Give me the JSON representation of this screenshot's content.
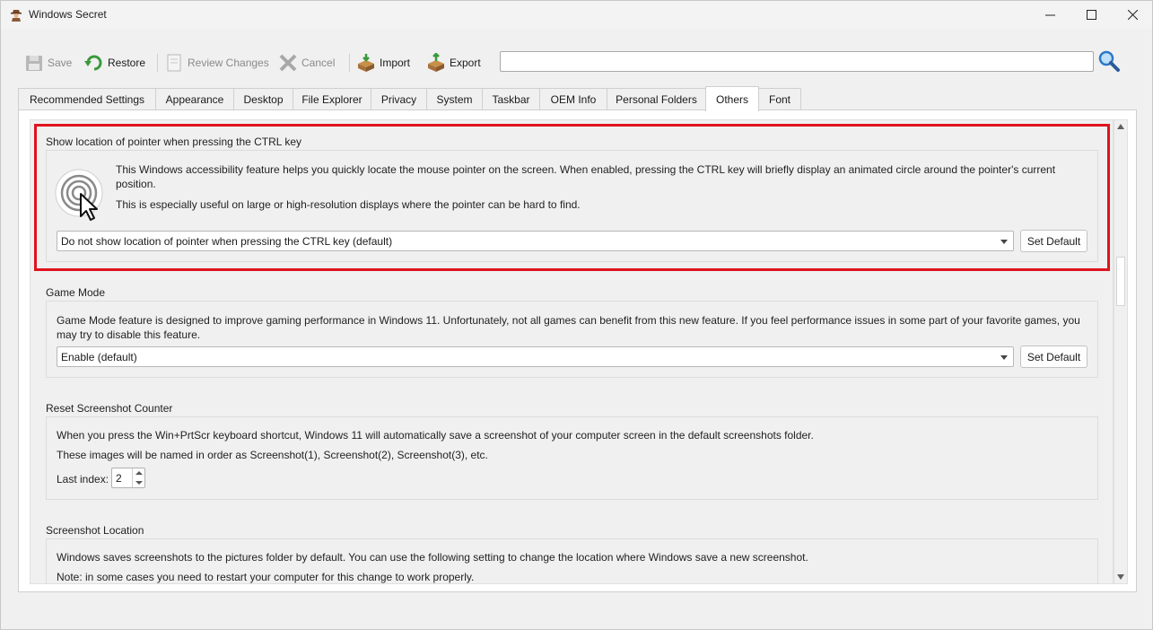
{
  "window": {
    "title": "Windows Secret",
    "icons": {
      "app": "spy-icon",
      "minimize": "minimize-icon",
      "maximize": "maximize-icon",
      "close": "close-icon"
    }
  },
  "toolbar": {
    "save": "Save",
    "restore": "Restore",
    "review": "Review Changes",
    "cancel": "Cancel",
    "import": "Import",
    "export": "Export",
    "search_value": "",
    "search_icon": "magnifier-icon"
  },
  "tabs": [
    {
      "label": "Recommended  Settings"
    },
    {
      "label": "Appearance"
    },
    {
      "label": "Desktop"
    },
    {
      "label": "File Explorer"
    },
    {
      "label": "Privacy"
    },
    {
      "label": "System"
    },
    {
      "label": "Taskbar"
    },
    {
      "label": "OEM Info"
    },
    {
      "label": "Personal Folders"
    },
    {
      "label": "Others",
      "active": true
    },
    {
      "label": "Font"
    }
  ],
  "sections": {
    "pointer": {
      "title": "Show location of pointer when pressing the CTRL key",
      "desc1": "This Windows accessibility feature helps you quickly locate the mouse pointer on the screen. When enabled, pressing the CTRL key will briefly display an animated circle around the pointer's current",
      "desc1b": "position.",
      "desc2": "This is especially useful on large or high-resolution displays where the pointer can be hard to find.",
      "combo": "Do not show location of pointer when pressing the CTRL key (default)",
      "button": "Set Default"
    },
    "game": {
      "title": "Game Mode",
      "desc1": "Game Mode feature is designed to improve gaming performance in Windows 11. Unfortunately, not all games can benefit from this new feature. If you feel performance issues in some part of your favorite games, you",
      "desc1b": "may try to disable this feature.",
      "combo": "Enable (default)",
      "button": "Set Default"
    },
    "screenshot_counter": {
      "title": "Reset Screenshot Counter",
      "desc1": "When you press the Win+PrtScr keyboard shortcut, Windows 11 will automatically save a screenshot of your computer screen in the default screenshots folder.",
      "desc2": "These images will be named in order as Screenshot(1), Screenshot(2), Screenshot(3), etc.",
      "index_label": "Last index:",
      "index_value": "2"
    },
    "screenshot_location": {
      "title": "Screenshot Location",
      "desc1": "Windows saves screenshots to the pictures folder by default. You can use the following setting to change the location where Windows save a new screenshot.",
      "desc2": "Note: in some cases you need to restart your computer for this change to work properly."
    }
  },
  "colors": {
    "highlight": "#e0141e",
    "accent": "#2a78c8"
  }
}
